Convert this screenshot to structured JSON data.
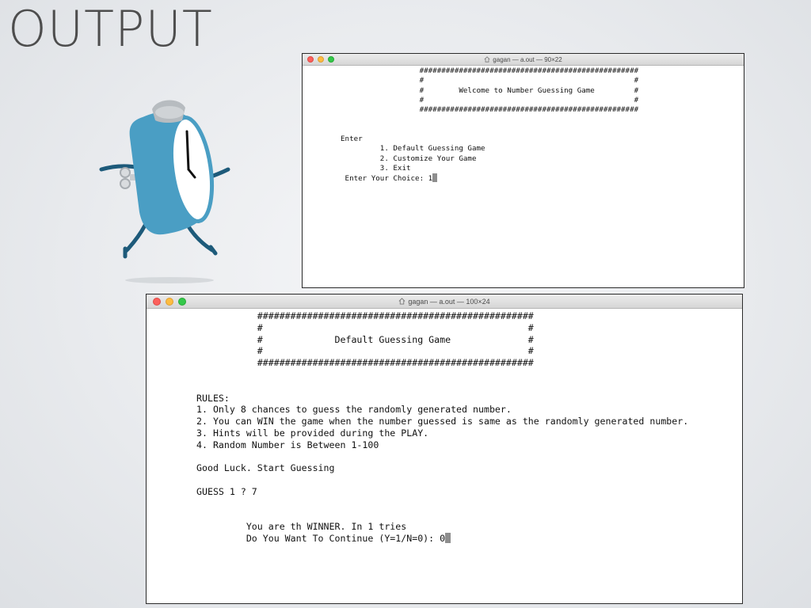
{
  "slide": {
    "title": "OUTPUT"
  },
  "colors": {
    "mascot_body": "#4a9ec4",
    "mascot_dark": "#1d5a7a",
    "bell": "#b7bcc0"
  },
  "terminal_1": {
    "window_title": "gagan — a.out — 90×22",
    "title_icon": "home-icon",
    "lines": [
      "                  ##################################################",
      "                  #                                                #",
      "                  #        Welcome to Number Guessing Game         #",
      "                  #                                                #",
      "                  ##################################################",
      "",
      "",
      "Enter",
      "         1. Default Guessing Game",
      "         2. Customize Your Game",
      "         3. Exit",
      " Enter Your Choice: "
    ],
    "input_value": "1"
  },
  "terminal_2": {
    "window_title": "gagan — a.out — 100×24",
    "title_icon": "home-icon",
    "lines": [
      "           ##################################################",
      "           #                                                #",
      "           #             Default Guessing Game              #",
      "           #                                                #",
      "           ##################################################",
      "",
      "",
      "RULES:",
      "1. Only 8 chances to guess the randomly generated number.",
      "2. You can WIN the game when the number guessed is same as the randomly generated number.",
      "3. Hints will be provided during the PLAY.",
      "4. Random Number is Between 1-100",
      "",
      "Good Luck. Start Guessing",
      "",
      "GUESS 1 ? 7",
      "",
      "",
      "         You are th WINNER. In 1 tries",
      "         Do You Want To Continue (Y=1/N=0): "
    ],
    "input_value": "0"
  }
}
